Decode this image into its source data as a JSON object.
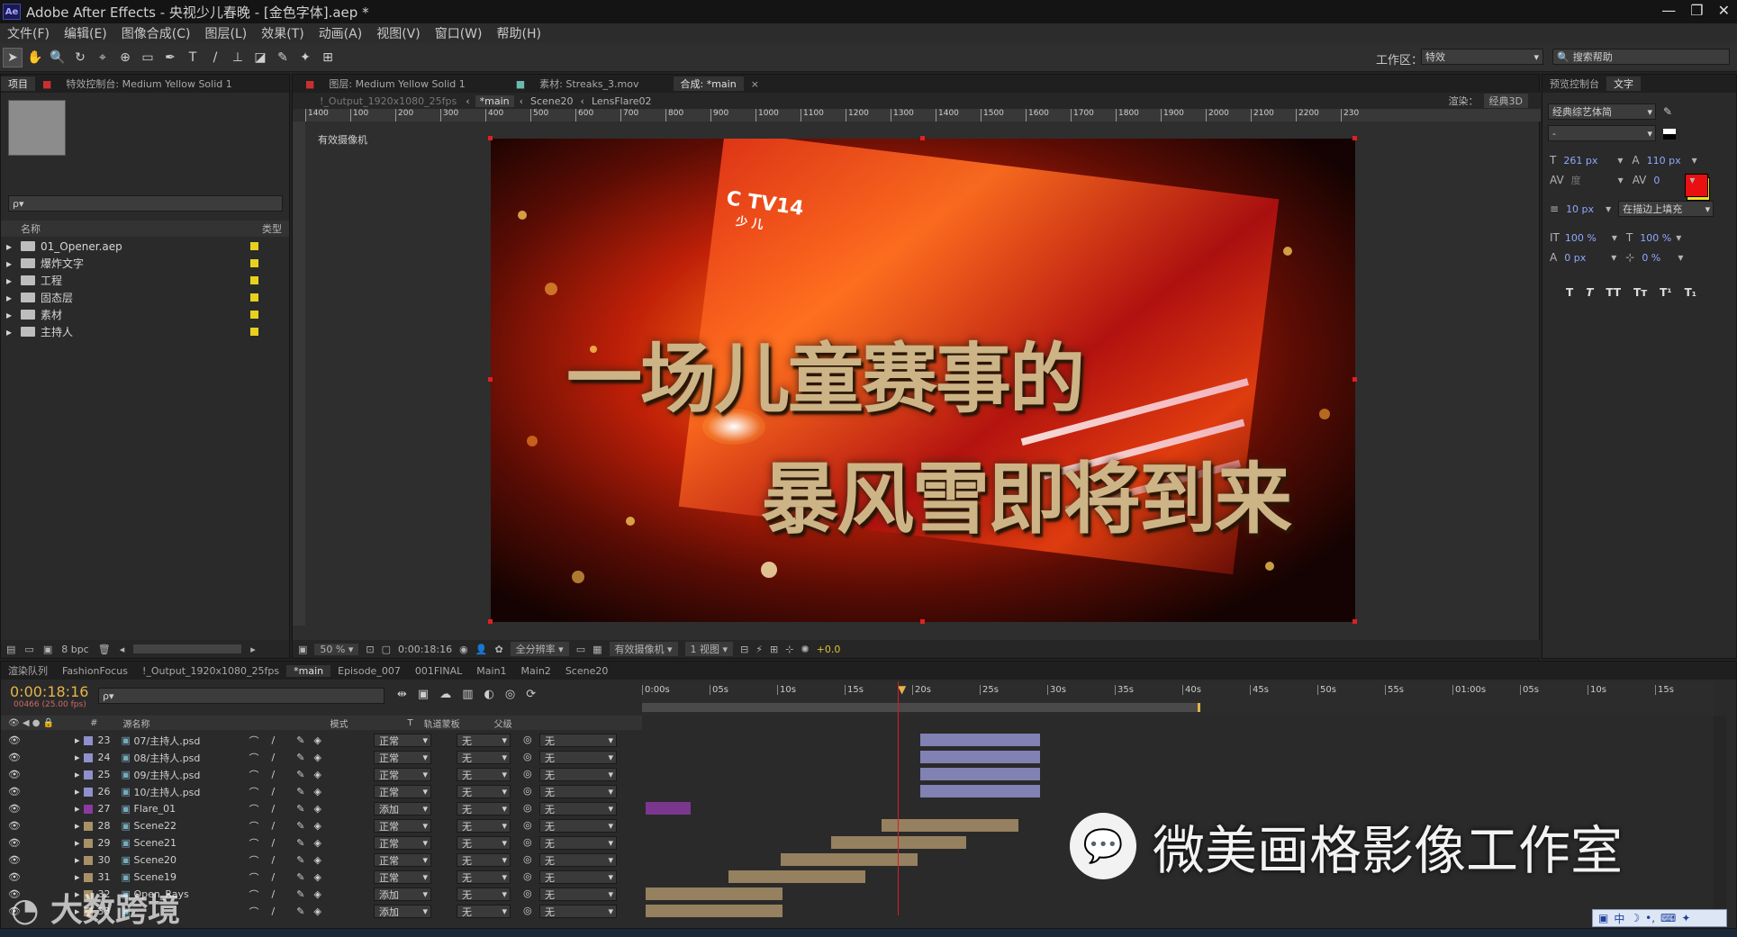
{
  "window": {
    "title": "Adobe After Effects - 央视少儿春晚 - [金色字体].aep *",
    "logo": "Ae",
    "controls": [
      "—",
      "❐",
      "✕"
    ]
  },
  "menu": [
    "文件(F)",
    "编辑(E)",
    "图像合成(C)",
    "图层(L)",
    "效果(T)",
    "动画(A)",
    "视图(V)",
    "窗口(W)",
    "帮助(H)"
  ],
  "toolbar": {
    "workspace_label": "工作区：",
    "workspace_value": "特效",
    "search_placeholder": "搜索帮助"
  },
  "project_panel": {
    "tab_project": "项目",
    "tab_effects": "特效控制台: Medium Yellow Solid 1",
    "search_value": "ρ▾",
    "col_name": "名称",
    "col_type": "类型",
    "items": [
      "01_Opener.aep",
      "爆炸文字",
      "工程",
      "固态层",
      "素材",
      "主持人"
    ],
    "footer_bpc": "8 bpc"
  },
  "viewer": {
    "tab_layer": "图层: Medium Yellow Solid 1",
    "tab_footage": "素材: Streaks_3.mov",
    "tab_comp": "合成: *main",
    "crumbs": [
      "!_Output_1920x1080_25fps",
      "*main",
      "Scene20",
      "LensFlare02"
    ],
    "renderer_label": "渲染：",
    "renderer_value": "经典3D",
    "camera_label": "有效摄像机",
    "ruler_ticks": [
      "1400",
      "100",
      "200",
      "300",
      "400",
      "500",
      "600",
      "700",
      "800",
      "900",
      "1000",
      "1100",
      "1200",
      "1300",
      "1400",
      "1500",
      "1600",
      "1700",
      "1800",
      "1900",
      "2000",
      "2100",
      "2200",
      "230"
    ],
    "logo_text": "C TV14",
    "logo_sub": "少 儿",
    "overlay_line1": "一场儿童赛事的",
    "overlay_line2": "暴风雪即将到来",
    "footer": {
      "zoom": "50 %",
      "timecode": "0:00:18:16",
      "resolution": "全分辨率",
      "camera": "有效摄像机",
      "views": "1 视图",
      "exposure": "+0.0"
    }
  },
  "right_panel": {
    "tabs": [
      "预览控制台",
      "文字"
    ],
    "font": "经典综艺体简",
    "style": "-",
    "font_size": "261 px",
    "leading": "110 px",
    "kerning": "度",
    "tracking": "0",
    "stroke_width": "10 px",
    "stroke_mode": "在描边上填充",
    "vscale": "100 %",
    "hscale": "100 %",
    "baseline": "0 px",
    "tsume": "0 %",
    "styles": [
      "T",
      "T",
      "TT",
      "Tт",
      "T¹",
      "T₁"
    ],
    "fill_color": "#e81010",
    "stroke_color": "#f0e020"
  },
  "timeline": {
    "tabs": [
      "渲染队列",
      "FashionFocus",
      "!_Output_1920x1080_25fps",
      "*main",
      "Episode_007",
      "001FINAL",
      "Main1",
      "Main2",
      "Scene20"
    ],
    "timecode": "0:00:18:16",
    "frame_info": "00466 (25.00 fps)",
    "search_value": "ρ▾",
    "col_num": "#",
    "col_name": "源名称",
    "col_mode": "模式",
    "col_t": "T",
    "col_trkmat": "轨道蒙板",
    "col_parent": "父级",
    "ruler": [
      "0:00s",
      "05s",
      "10s",
      "15s",
      "20s",
      "25s",
      "30s",
      "35s",
      "40s",
      "45s",
      "50s",
      "55s",
      "01:00s",
      "05s",
      "10s",
      "15s"
    ],
    "layers": [
      {
        "num": "23",
        "name": "07/主持人.psd",
        "mode": "正常",
        "trk": "无",
        "parent": "无",
        "color": "#9090cc"
      },
      {
        "num": "24",
        "name": "08/主持人.psd",
        "mode": "正常",
        "trk": "无",
        "parent": "无",
        "color": "#9090cc"
      },
      {
        "num": "25",
        "name": "09/主持人.psd",
        "mode": "正常",
        "trk": "无",
        "parent": "无",
        "color": "#9090cc"
      },
      {
        "num": "26",
        "name": "10/主持人.psd",
        "mode": "正常",
        "trk": "无",
        "parent": "无",
        "color": "#9090cc"
      },
      {
        "num": "27",
        "name": "Flare_01",
        "mode": "添加",
        "trk": "无",
        "parent": "无",
        "color": "#8a3aa0"
      },
      {
        "num": "28",
        "name": "Scene22",
        "mode": "正常",
        "trk": "无",
        "parent": "无",
        "color": "#a89068"
      },
      {
        "num": "29",
        "name": "Scene21",
        "mode": "正常",
        "trk": "无",
        "parent": "无",
        "color": "#a89068"
      },
      {
        "num": "30",
        "name": "Scene20",
        "mode": "正常",
        "trk": "无",
        "parent": "无",
        "color": "#a89068"
      },
      {
        "num": "31",
        "name": "Scene19",
        "mode": "正常",
        "trk": "无",
        "parent": "无",
        "color": "#a89068"
      },
      {
        "num": "32",
        "name": "Open_Rays",
        "mode": "添加",
        "trk": "无",
        "parent": "无",
        "color": "#a89068"
      },
      {
        "num": "33",
        "name": "",
        "mode": "添加",
        "trk": "无",
        "parent": "无",
        "color": "#a89068"
      }
    ]
  },
  "watermark": {
    "studio": "微美画格影像工作室",
    "corner": "大数跨境"
  },
  "ime": "中"
}
